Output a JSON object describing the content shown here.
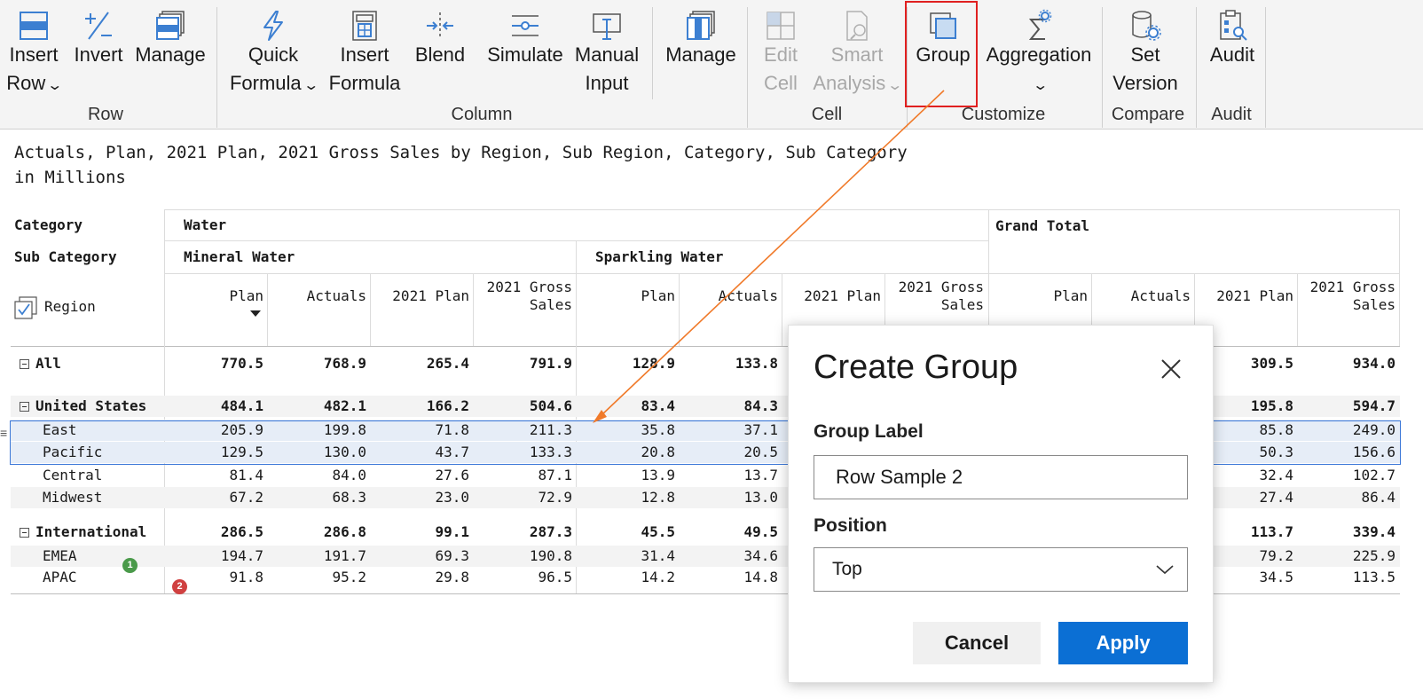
{
  "ribbon": {
    "row_group": {
      "label": "Row",
      "insert_row": [
        "Insert",
        "Row"
      ],
      "invert": "Invert",
      "manage": "Manage"
    },
    "column_group": {
      "label": "Column",
      "quick_formula": [
        "Quick",
        "Formula"
      ],
      "insert_formula": [
        "Insert",
        "Formula"
      ],
      "blend": "Blend",
      "simulate": "Simulate",
      "manual_input": [
        "Manual",
        "Input"
      ],
      "manage": "Manage"
    },
    "cell_group": {
      "label": "Cell",
      "edit_cell": [
        "Edit",
        "Cell"
      ],
      "smart_analysis": [
        "Smart",
        "Analysis"
      ]
    },
    "customize_group": {
      "label": "Customize",
      "group": "Group",
      "aggregation": "Aggregation"
    },
    "compare_group": {
      "label": "Compare",
      "set_version": [
        "Set",
        "Version"
      ]
    },
    "audit_group": {
      "label": "Audit",
      "audit": "Audit"
    },
    "colors": {
      "icon_blue": "#3c7fd1",
      "disabled": "#a8a8a8",
      "highlight_red": "#e02020"
    }
  },
  "report": {
    "title_line1": "Actuals, Plan, 2021 Plan, 2021 Gross Sales by Region, Sub Region, Category, Sub Category",
    "title_line2": "in Millions"
  },
  "table": {
    "header": {
      "category_label": "Category",
      "sub_category_label": "Sub Category",
      "region_label": "Region",
      "category_water": "Water",
      "grand_total": "Grand Total",
      "sub_mineral": "Mineral Water",
      "sub_sparkling": "Sparkling Water"
    },
    "measures": [
      "Plan",
      "Actuals",
      "2021 Plan",
      "2021 Gross Sales"
    ],
    "rows": [
      {
        "label": "All",
        "level": 0,
        "bold": true,
        "collapsible": true,
        "mineral": [
          "770.5",
          "768.9",
          "265.4",
          "791.9"
        ],
        "sparkling": [
          "128.9",
          "133.8"
        ],
        "grand": [
          "309.5",
          "934.0"
        ]
      },
      {
        "label": "United States",
        "level": 0,
        "bold": true,
        "collapsible": true,
        "mineral": [
          "484.1",
          "482.1",
          "166.2",
          "504.6"
        ],
        "sparkling": [
          "83.4",
          "84.3"
        ],
        "grand": [
          "195.8",
          "594.7"
        ]
      },
      {
        "label": "East",
        "level": 1,
        "bold": false,
        "selected": true,
        "mineral": [
          "205.9",
          "199.8",
          "71.8",
          "211.3"
        ],
        "sparkling": [
          "35.8",
          "37.1"
        ],
        "grand": [
          "85.8",
          "249.0"
        ]
      },
      {
        "label": "Pacific",
        "level": 1,
        "bold": false,
        "selected": true,
        "mineral": [
          "129.5",
          "130.0",
          "43.7",
          "133.3"
        ],
        "sparkling": [
          "20.8",
          "20.5"
        ],
        "grand": [
          "50.3",
          "156.6"
        ]
      },
      {
        "label": "Central",
        "level": 1,
        "bold": false,
        "mineral": [
          "81.4",
          "84.0",
          "27.6",
          "87.1"
        ],
        "sparkling": [
          "13.9",
          "13.7"
        ],
        "grand": [
          "32.4",
          "102.7"
        ]
      },
      {
        "label": "Midwest",
        "level": 1,
        "bold": false,
        "mineral": [
          "67.2",
          "68.3",
          "23.0",
          "72.9"
        ],
        "sparkling": [
          "12.8",
          "13.0"
        ],
        "grand": [
          "27.4",
          "86.4"
        ]
      },
      {
        "label": "International",
        "level": 0,
        "bold": true,
        "collapsible": true,
        "mineral": [
          "286.5",
          "286.8",
          "99.1",
          "287.3"
        ],
        "sparkling": [
          "45.5",
          "49.5"
        ],
        "grand": [
          "113.7",
          "339.4"
        ]
      },
      {
        "label": "EMEA",
        "level": 1,
        "bold": false,
        "mineral": [
          "194.7",
          "191.7",
          "69.3",
          "190.8"
        ],
        "sparkling": [
          "31.4",
          "34.6"
        ],
        "grand": [
          "79.2",
          "225.9"
        ]
      },
      {
        "label": "APAC",
        "level": 1,
        "bold": false,
        "mineral": [
          "91.8",
          "95.2",
          "29.8",
          "96.5"
        ],
        "sparkling": [
          "14.2",
          "14.8"
        ],
        "grand": [
          "34.5",
          "113.5"
        ]
      }
    ],
    "badges": {
      "emea": "1",
      "apac": "2",
      "green": "#4a9a4a",
      "red": "#d04040"
    }
  },
  "dialog": {
    "title": "Create Group",
    "group_label_caption": "Group Label",
    "group_label_value": "Row Sample 2",
    "position_caption": "Position",
    "position_value": "Top",
    "cancel_label": "Cancel",
    "apply_label": "Apply",
    "apply_color": "#0b6fd4"
  },
  "annotation": {
    "arrow_color": "#f07a2a"
  }
}
